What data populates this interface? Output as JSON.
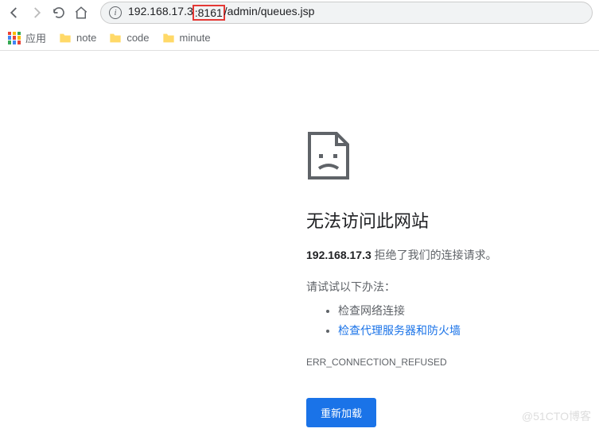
{
  "toolbar": {
    "url_prefix": "192.168.17.3",
    "url_port": ":8161",
    "url_suffix": "/admin/queues.jsp"
  },
  "bookmarks": {
    "apps_label": "应用",
    "items": [
      {
        "label": "note"
      },
      {
        "label": "code"
      },
      {
        "label": "minute"
      }
    ]
  },
  "error": {
    "title": "无法访问此网站",
    "host_bold": "192.168.17.3",
    "desc_rest": " 拒绝了我们的连接请求。",
    "try_label": "请试试以下办法：",
    "check_net": "检查网络连接",
    "check_proxy": "检查代理服务器和防火墙",
    "code": "ERR_CONNECTION_REFUSED",
    "reload_label": "重新加载"
  },
  "watermark": "@51CTO博客"
}
